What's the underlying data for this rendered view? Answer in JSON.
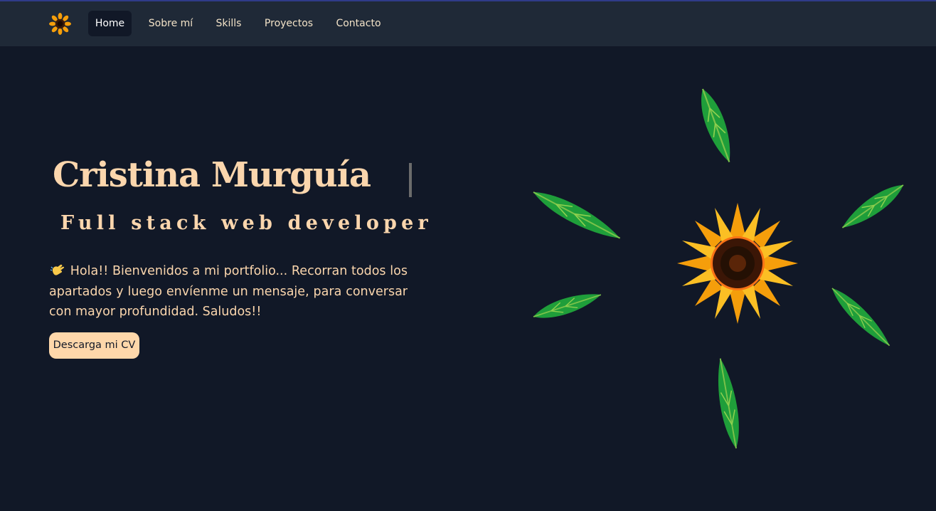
{
  "nav": {
    "logo_icon": "sunflower-icon",
    "links": [
      {
        "label": "Home",
        "active": true
      },
      {
        "label": "Sobre mí",
        "active": false
      },
      {
        "label": "Skills",
        "active": false
      },
      {
        "label": "Proyectos",
        "active": false
      },
      {
        "label": "Contacto",
        "active": false
      }
    ]
  },
  "hero": {
    "name": "Cristina Murguía",
    "role": "Full stack web developer",
    "greeting_icon": "waving-hand-icon",
    "intro": "Hola!! Bienvenidos a mi portfolio... Recorran todos los apartados y luego envíenme un mensaje, para conversar con mayor profundidad. Saludos!!",
    "cv_button": "Descarga mi CV",
    "illustration_icon": "sunflower-with-leaves-icon"
  },
  "colors": {
    "background": "#111827",
    "navbar": "#1f2937",
    "accent": "#fbd6ad",
    "button": "#fed7aa"
  }
}
